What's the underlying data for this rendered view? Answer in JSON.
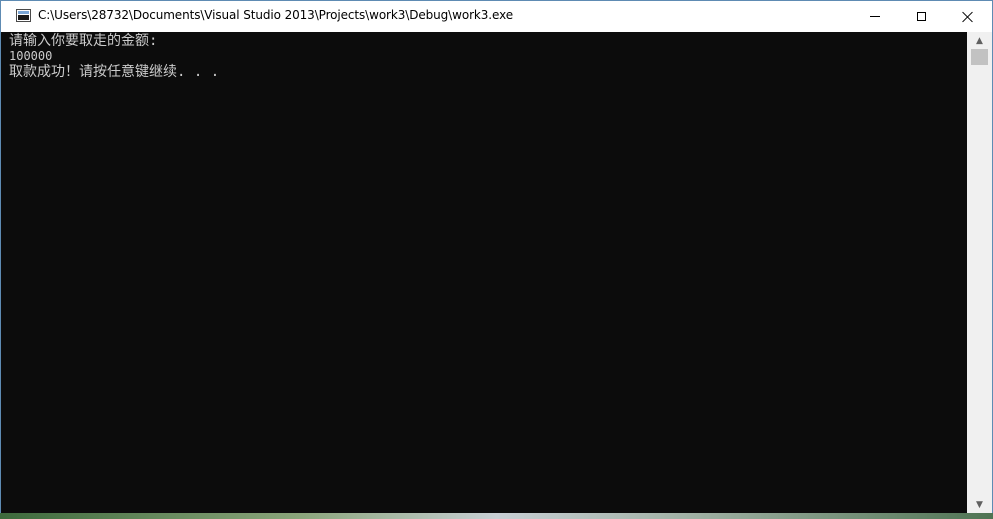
{
  "window": {
    "title": "C:\\Users\\28732\\Documents\\Visual Studio 2013\\Projects\\work3\\Debug\\work3.exe",
    "icon": "console-app-icon",
    "buttons": {
      "minimize": "minimize-icon",
      "maximize": "maximize-icon",
      "close": "close-icon"
    }
  },
  "console": {
    "lines": [
      "请输入你要取走的金额:",
      "100000",
      "取款成功！请按任意键继续. . ."
    ],
    "background": "#0c0c0c",
    "foreground": "#cccccc"
  },
  "scrollbar": {
    "up_arrow": "▲",
    "down_arrow": "▼"
  }
}
